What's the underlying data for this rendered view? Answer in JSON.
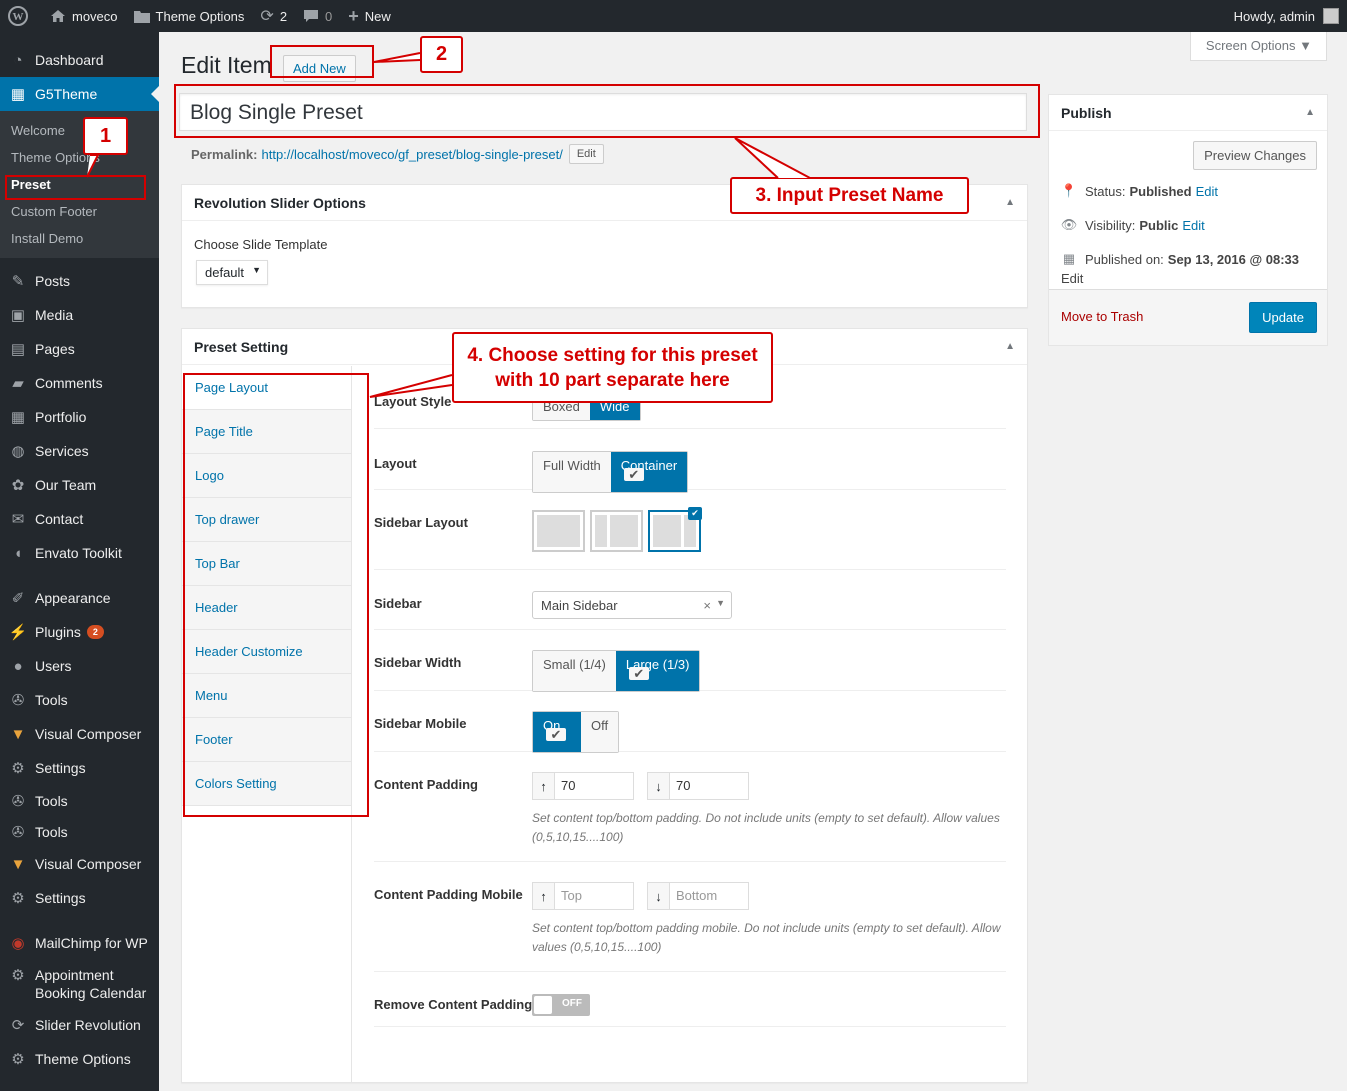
{
  "adminbar": {
    "site": "moveco",
    "theme_options": "Theme Options",
    "updates": "2",
    "comments": "0",
    "new": "New",
    "howdy": "Howdy, admin"
  },
  "sidebar": {
    "dashboard": "Dashboard",
    "g5theme": "G5Theme",
    "sub": [
      "Welcome",
      "Theme Options",
      "Preset",
      "Custom Footer",
      "Install Demo"
    ],
    "items": [
      "Posts",
      "Media",
      "Pages",
      "Comments",
      "Portfolio",
      "Services",
      "Our Team",
      "Contact",
      "Envato Toolkit"
    ],
    "items2": [
      "Appearance",
      "Plugins",
      "Users",
      "Tools",
      "Visual Composer",
      "Settings",
      "Tools",
      "Tools",
      "Visual Composer",
      "Settings"
    ],
    "plugins_badge": "2",
    "items3": [
      "MailChimp for WP",
      "Appointment Booking Calendar",
      "Slider Revolution",
      "Theme Options"
    ]
  },
  "page": {
    "screen_options": "Screen Options ▼",
    "title": "Edit Item",
    "add_new": "Add New",
    "post_title": "Blog Single Preset",
    "permalink_label": "Permalink:",
    "permalink_url": "http://localhost/moveco/gf_preset/blog-single-preset/",
    "edit": "Edit"
  },
  "rev": {
    "title": "Revolution Slider Options",
    "choose": "Choose Slide Template",
    "select": "default"
  },
  "preset": {
    "title": "Preset Setting",
    "tabs": [
      "Page Layout",
      "Page Title",
      "Logo",
      "Top drawer",
      "Top Bar",
      "Header",
      "Header Customize",
      "Menu",
      "Footer",
      "Colors Setting"
    ],
    "layout_style": {
      "label": "Layout Style",
      "opt1": "Boxed",
      "opt2": "Wide"
    },
    "layout": {
      "label": "Layout",
      "opt1": "Full Width",
      "opt2": "Container"
    },
    "sidebar_layout": {
      "label": "Sidebar Layout"
    },
    "sidebar": {
      "label": "Sidebar",
      "value": "Main Sidebar"
    },
    "sidebar_width": {
      "label": "Sidebar Width",
      "opt1": "Small (1/4)",
      "opt2": "Large (1/3)"
    },
    "sidebar_mobile": {
      "label": "Sidebar Mobile",
      "opt1": "On",
      "opt2": "Off"
    },
    "content_padding": {
      "label": "Content Padding",
      "top": "70",
      "bottom": "70",
      "desc": "Set content top/bottom padding. Do not include units (empty to set default). Allow values (0,5,10,15....100)"
    },
    "content_padding_mobile": {
      "label": "Content Padding Mobile",
      "top_ph": "Top",
      "bottom_ph": "Bottom",
      "desc": "Set content top/bottom padding mobile. Do not include units (empty to set default). Allow values (0,5,10,15....100)"
    },
    "remove_padding": {
      "label": "Remove Content Padding",
      "state": "OFF"
    }
  },
  "publish": {
    "title": "Publish",
    "preview": "Preview Changes",
    "status_label": "Status:",
    "status": "Published",
    "visibility_label": "Visibility:",
    "visibility": "Public",
    "published_label": "Published on:",
    "published": "Sep 13, 2016 @ 08:33",
    "edit": "Edit",
    "trash": "Move to Trash",
    "update": "Update"
  },
  "callouts": {
    "c1": "1",
    "c2": "2",
    "c3": "3. Input Preset Name",
    "c4a": "4. Choose setting for this preset",
    "c4b": "with 10 part separate here"
  },
  "colors": {
    "accent": "#0073aa",
    "callout": "#d40000",
    "sidebar_bg": "#23282d"
  }
}
